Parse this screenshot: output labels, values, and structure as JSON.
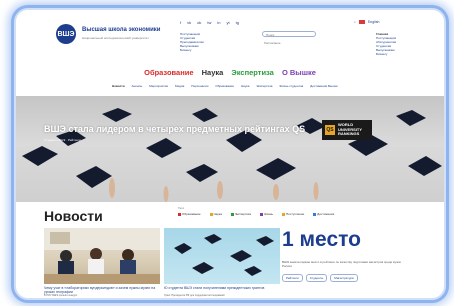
{
  "header": {
    "logo_text": "ВШЭ",
    "site_title": "Высшая школа экономики",
    "site_subtitle": "Национальный исследовательский университет",
    "social_icons": [
      "f",
      "vk",
      "ok",
      "tw",
      "in",
      "yt",
      "tg"
    ],
    "col1_links": [
      "Поступающим",
      "Студентам",
      "Преподавателям",
      "Выпускникам",
      "Бизнесу"
    ],
    "search_placeholder": "Поиск",
    "search_note": "Расписание",
    "language": "English",
    "col2_links": [
      "Главная",
      "Поступающим",
      "Абитуриентам",
      "Студентам",
      "Выпускникам",
      "Бизнесу"
    ]
  },
  "main_menu": {
    "items": [
      {
        "label": "Образование",
        "color": "#d52d2d"
      },
      {
        "label": "Наука",
        "color": "#333333"
      },
      {
        "label": "Экспертиза",
        "color": "#2d9a3f"
      },
      {
        "label": "О Вышке",
        "color": "#7b3fb2"
      }
    ]
  },
  "sub_nav": {
    "items": [
      "Новости",
      "Анонсы",
      "Мероприятия",
      "Медиа",
      "Персоналии",
      "Образование",
      "Наука",
      "Экспертиза",
      "Жизнь студентов",
      "Достижения Вышки"
    ]
  },
  "hero": {
    "title": "ВШЭ стала лидером в четырех предметных рейтингах QS",
    "subtitle": "Студенты ВШЭ · Рейтинги",
    "badge_mark": "QS",
    "badge_lines": [
      "WORLD",
      "UNIVERSITY",
      "RANKINGS"
    ]
  },
  "news": {
    "title": "Новости",
    "filters_label": "Теги",
    "filters": [
      {
        "label": "Образование",
        "color": "#d52d2d"
      },
      {
        "label": "Наука",
        "color": "#e7a523"
      },
      {
        "label": "Экспертиза",
        "color": "#2d9a3f"
      },
      {
        "label": "Жизнь",
        "color": "#7b3fb2"
      },
      {
        "label": "Поступление",
        "color": "#e7a523"
      },
      {
        "label": "Достижения",
        "color": "#3a7bd5"
      }
    ],
    "cards": [
      {
        "caption": "Чему учат в «лабораториях вундеркиндов» и зачем нужны музеи на уроках географии",
        "subcaption": "В НИУ ВШЭ прошёл конкурс"
      },
      {
        "caption": "Ю студента ВШЭ стали получателями президентских грантов",
        "subcaption": "Грант Президента РФ для поддержки исследований"
      }
    ],
    "highlight": {
      "value": "1 место",
      "description": "ВШЭ заняла первое место в рейтинге по качеству подготовки магистров среди вузов России",
      "tags": [
        "Рейтинги",
        "Студенты",
        "Магистратура"
      ]
    }
  }
}
